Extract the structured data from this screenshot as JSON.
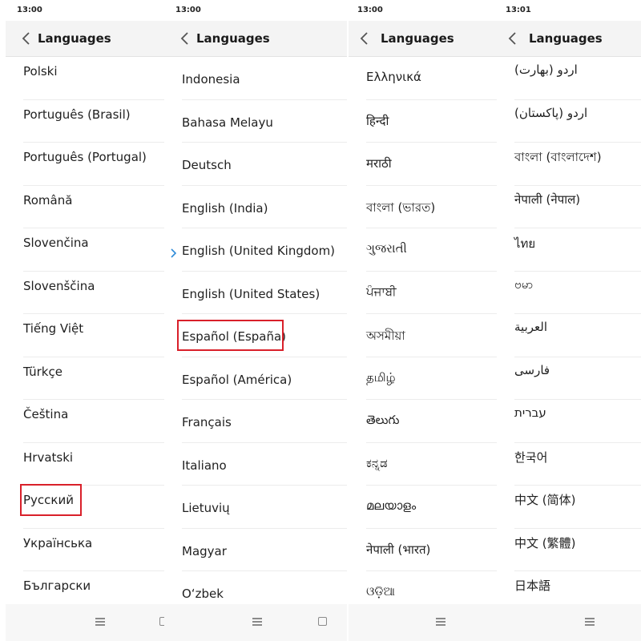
{
  "panels": [
    {
      "time": "13:00",
      "title": "Languages",
      "items": [
        "Polski",
        "Português (Brasil)",
        "Português (Portugal)",
        "Română",
        "Slovenčina",
        "Slovenščina",
        "Tiếng Việt",
        "Türkçe",
        "Čeština",
        "Hrvatski",
        "Русский",
        "Українська",
        "Български"
      ],
      "highlighted": "Русский"
    },
    {
      "time": "13:00",
      "title": "Languages",
      "items": [
        "Indonesia",
        "Bahasa Melayu",
        "Deutsch",
        "English (India)",
        "English (United Kingdom)",
        "English (United States)",
        "Español (España)",
        "Español (América)",
        "Français",
        "Italiano",
        "Lietuvių",
        "Magyar",
        "Oʻzbek"
      ],
      "selected": "English (United Kingdom)",
      "highlighted": "Español (España)"
    },
    {
      "time": "13:00",
      "title": "Languages",
      "items": [
        "Ελληνικά",
        "हिन्दी",
        "मराठी",
        "বাংলা (ভারত)",
        "ગુજરાતી",
        "ਪੰਜਾਬੀ",
        "অসমীয়া",
        "தமிழ்",
        "తెలుగు",
        "ಕನ್ನಡ",
        "മലയാളം",
        "नेपाली (भारत)",
        "ଓଡ଼ିଆ"
      ]
    },
    {
      "time": "13:01",
      "title": "Languages",
      "items": [
        "اردو (بھارت)",
        "اردو (پاکستان)",
        "বাংলা (বাংলাদেশ)",
        "नेपाली (नेपाल)",
        "ไทย",
        "ဗမာ",
        "العربية",
        "فارسی",
        "עברית",
        "한국어",
        "中文 (简体)",
        "中文 (繁體)",
        "日本語"
      ]
    }
  ],
  "colors": {
    "highlight_border": "#d9202a",
    "selected_arrow": "#2e8bd8",
    "header_bg": "#f4f4f4"
  },
  "icons": {
    "back": "chevron-left-icon",
    "menu": "menu-icon",
    "home": "square-home-icon",
    "selected": "chevron-right-icon"
  }
}
